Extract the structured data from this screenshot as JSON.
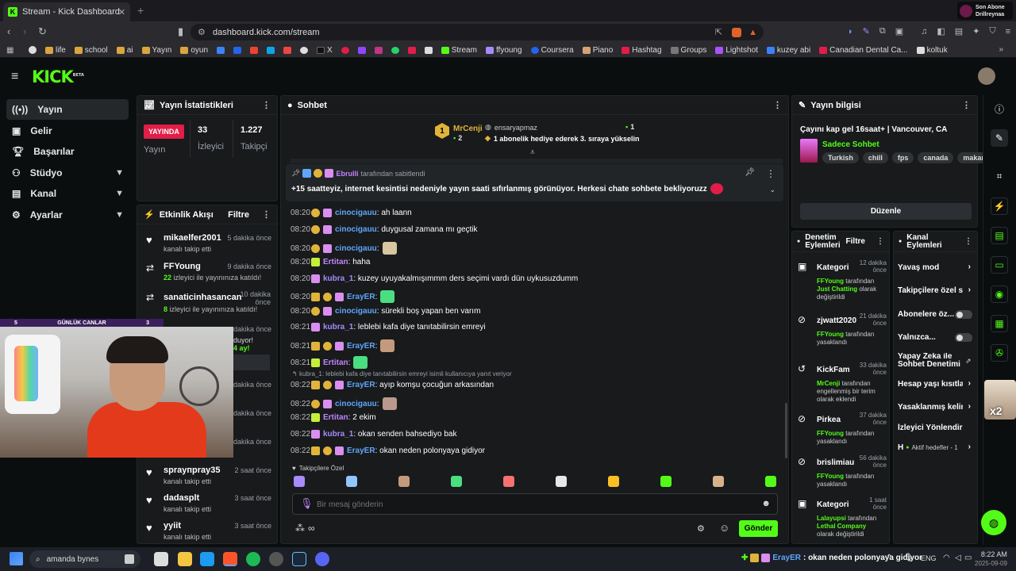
{
  "browser": {
    "tab_title": "Stream - Kick Dashboard",
    "url": "dashboard.kick.com/stream",
    "top_right": {
      "line1": "Son Abone",
      "line2": "Drillreynaa"
    },
    "bookmarks": [
      "life",
      "school",
      "ai",
      "Yayın",
      "oyun",
      "X",
      "Stream",
      "ffyoung",
      "Coursera",
      "Piano",
      "Hashtag",
      "Groups",
      "Lightshot",
      "kuzey abi",
      "Canadian Dental Ca...",
      "koltuk"
    ]
  },
  "header": {
    "logo": "KICK",
    "logo_sup": "BETA"
  },
  "sidebar": {
    "items": [
      {
        "label": "Yayın"
      },
      {
        "label": "Gelir"
      },
      {
        "label": "Başarılar"
      },
      {
        "label": "Stüdyo"
      },
      {
        "label": "Kanal"
      },
      {
        "label": "Ayarlar"
      }
    ]
  },
  "stats": {
    "title": "Yayın İstatistikleri",
    "live_badge": "YAYINDA",
    "live_label": "Yayın",
    "viewers": "33",
    "viewers_label": "İzleyici",
    "followers": "1.227",
    "followers_label": "Takipçi"
  },
  "activity": {
    "title": "Etkinlik Akışı",
    "filter": "Filtre",
    "items": [
      {
        "name": "mikaelfer2001",
        "sub": "kanalı takip etti",
        "time": "5 dakika önce"
      },
      {
        "name": "FFYoung",
        "sub_count": "22",
        "sub": "izleyici ile yayınınıza katıldı!",
        "time": "9 dakika önce"
      },
      {
        "name": "sanaticinhasancan",
        "sub_count": "8",
        "sub": "izleyici ile yayınınıza katıldı!",
        "time": "10 dakika önce"
      },
      {
        "name": "sprayпpray35",
        "sub": "kanalı takip etti",
        "time": "2 saat önce"
      },
      {
        "name": "dadasplt",
        "sub": "kanalı takip etti",
        "time": "3 saat önce"
      },
      {
        "name": "yyiit",
        "sub": "kanalı takip etti",
        "time": "3 saat önce"
      }
    ],
    "partial": {
      "time1": "dakika önce",
      "t1": "duyor!",
      "t2": "4 ay!",
      "time2": "dakika önce",
      "time3": "dakika önce",
      "time4": "dakika önce"
    }
  },
  "webcam": {
    "left_num": "5",
    "title": "GÜNLÜK CANLAR",
    "right_num": "3"
  },
  "chat": {
    "title": "Sohbet",
    "leaderboard": {
      "rank": "1",
      "user": "MrCenji",
      "user_count": "2",
      "user2": "ensaryapmaz",
      "user2_count": "1",
      "gift_text": "1 abonelik hediye ederek 3. sıraya yükselin"
    },
    "pinned": {
      "by": "Ebrulli",
      "by_suffix": "tarafından sabitlendi",
      "text": "+15 saatteyiz, internet kesintisi nedeniyle yayın saati sıfırlanmış görünüyor. Herkesi chate sohbete bekliyoruzz"
    },
    "messages": [
      {
        "time": "08:20",
        "user": "cinocigauu",
        "color": "#60a5fa",
        "text": ": ah laann"
      },
      {
        "time": "08:20",
        "user": "cinocigauu",
        "color": "#60a5fa",
        "text": ": duygusal zamana mı geçtik"
      },
      {
        "time": "08:20",
        "user": "cinocigauu",
        "color": "#60a5fa",
        "text": ":"
      },
      {
        "time": "08:20",
        "user": "Ertitan",
        "color": "#c084fc",
        "text": ": haha"
      },
      {
        "time": "08:20",
        "user": "kubra_1",
        "color": "#a78bfa",
        "text": ": kuzey uyuyakalmışımmm ders seçimi vardı dün uykusuzdumm"
      },
      {
        "time": "08:20",
        "user": "ErayER",
        "color": "#60a5fa",
        "text": ":"
      },
      {
        "time": "08:20",
        "user": "cinocigauu",
        "color": "#60a5fa",
        "text": ": sürekli boş yapan ben varım"
      },
      {
        "time": "08:21",
        "user": "kubra_1",
        "color": "#a78bfa",
        "text": ": leblebi kafa diye tanıtabilirsin emreyi"
      },
      {
        "time": "08:21",
        "user": "ErayER",
        "color": "#60a5fa",
        "text": ":"
      },
      {
        "time": "08:21",
        "user": "Ertitan",
        "color": "#c084fc",
        "text": ":"
      },
      {
        "time": "08:22",
        "user": "ErayER",
        "color": "#60a5fa",
        "text": ": ayıp komşu çocuğun arkasından"
      },
      {
        "time": "08:22",
        "user": "cinocigauu",
        "color": "#60a5fa",
        "text": ":"
      },
      {
        "time": "08:22",
        "user": "Ertitan",
        "color": "#c084fc",
        "text": ": 2 ekim"
      },
      {
        "time": "08:22",
        "user": "kubra_1",
        "color": "#a78bfa",
        "text": ": okan senden bahsediyo bak"
      },
      {
        "time": "08:22",
        "user": "ErayER",
        "color": "#60a5fa",
        "text": ": okan neden polonyaya gidiyor"
      }
    ],
    "reply_ref": "kubra_1: leblebi kafa diye tanıtabilirsin emreyi isimli kullanıcıya yanıt veriyor",
    "emote_section": "Takipçilere Özel",
    "input_placeholder": "Bir mesaj gönderin",
    "send": "Gönder"
  },
  "stream_info": {
    "title": "Yayın bilgisi",
    "stream_title": "Çayını kap gel 16saat+ | Vancouver, CA",
    "category": "Sadece Sohbet",
    "tags": [
      "Turkish",
      "chill",
      "fps",
      "canada",
      "makara"
    ],
    "edit": "Düzenle"
  },
  "mod": {
    "title": "Denetim Eylemleri",
    "filter": "Filtre",
    "items": [
      {
        "name": "Kategori",
        "time": "12 dakika önce",
        "actor": "FFYoung",
        "l1": "tarafından",
        "highlight": "Just Chatting",
        "l2": "olarak değiştirildi"
      },
      {
        "name": "zjwatt2020",
        "time": "21 dakika önce",
        "actor": "FFYoung",
        "l1": "tarafından",
        "l2": "yasaklandı"
      },
      {
        "name": "KickFam",
        "time": "33 dakika önce",
        "actor": "MrCenji",
        "l1": "tarafından",
        "l2": "engellenmiş bir terim olarak eklendi"
      },
      {
        "name": "Pirkea",
        "time": "37 dakika önce",
        "actor": "FFYoung",
        "l1": "tarafından",
        "l2": "yasaklandı"
      },
      {
        "name": "brislimiau",
        "time": "56 dakika önce",
        "actor": "FFYoung",
        "l1": "tarafından",
        "l2": "yasaklandı"
      },
      {
        "name": "Kategori",
        "time": "1 saat önce",
        "actor": "Lalayupsi",
        "l1": "tarafından",
        "highlight": "Lethal Company",
        "l2": "olarak değiştirildi"
      }
    ]
  },
  "channel_actions": {
    "title": "Kanal Eylemleri",
    "items": [
      "Yavaş mod",
      "Takipçilere özel so",
      "Abonelere öz...",
      "Yalnızca...",
      "Yapay Zeka ile Sohbet Denetimi",
      "Hesap yaşı kısıtla",
      "Yasaklanmış kelim",
      "İzleyici Yönlendir"
    ],
    "goals": {
      "prefix": "H",
      "text": "Aktif hedefler - 1"
    }
  },
  "taskbar": {
    "search": "amanda bynes",
    "notif_user": "ErayER",
    "notif_text": ": okan neden polonyaya gidiyor",
    "lang": "ENG",
    "time": "8:22 AM",
    "date": "2025-09-09"
  },
  "overlay": {
    "x2": "x2"
  },
  "colors": {
    "accent": "#53fc18",
    "live": "#e11d48",
    "bg": "#0b0e0f",
    "panel": "#181a1c"
  }
}
